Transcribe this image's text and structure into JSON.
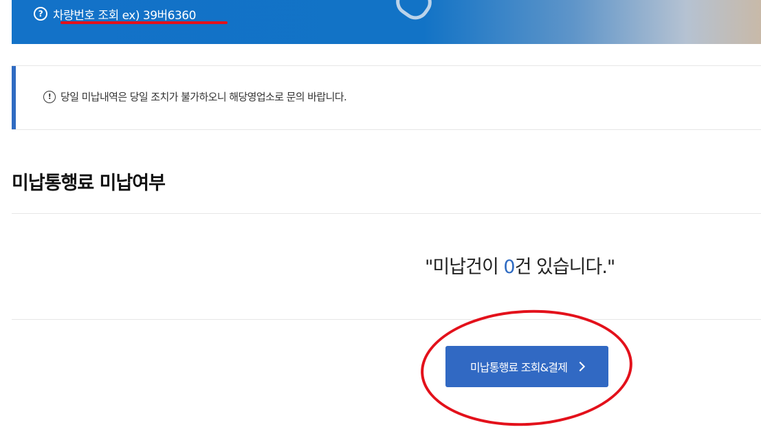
{
  "banner": {
    "help_icon": "question-circle-icon",
    "help_text": "차량번호 조회 ex) 39버6360"
  },
  "notice": {
    "icon": "exclamation-circle-icon",
    "text": "당일 미납내역은 당일 조치가 불가하오니 해당영업소로 문의 바랍니다."
  },
  "section": {
    "title": "미납통행료 미납여부"
  },
  "result": {
    "prefix": "\"미납건이 ",
    "count": "0",
    "suffix": "건 있습니다.\""
  },
  "button": {
    "label": "미납통행료 조회&결제",
    "icon": "chevron-right-icon"
  },
  "colors": {
    "brand_blue": "#3169c3",
    "annotation_red": "#e3111b"
  }
}
